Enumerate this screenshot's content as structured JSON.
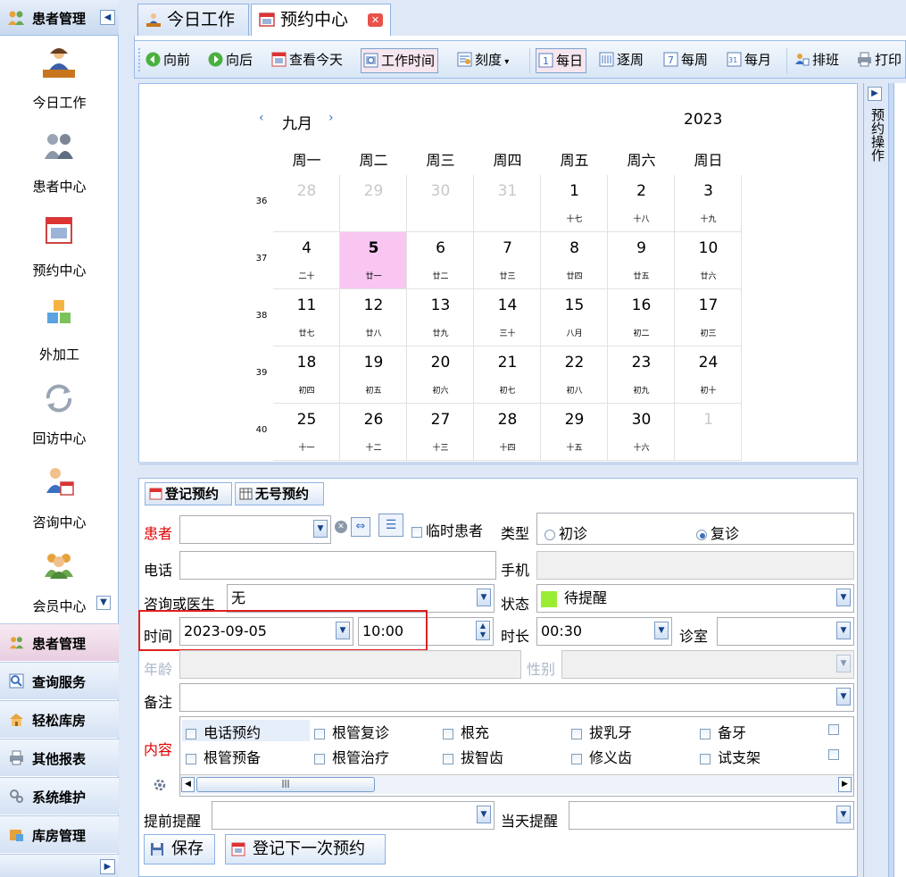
{
  "sidebar": {
    "title": "患者管理",
    "nav_items": [
      {
        "label": "今日工作",
        "icon": "doctor-desk-icon"
      },
      {
        "label": "患者中心",
        "icon": "patients-icon"
      },
      {
        "label": "预约中心",
        "icon": "calendar-icon"
      },
      {
        "label": "外加工",
        "icon": "cubes-icon"
      },
      {
        "label": "回访中心",
        "icon": "refresh-icon"
      },
      {
        "label": "咨询中心",
        "icon": "consult-icon"
      },
      {
        "label": "会员中心",
        "icon": "members-icon"
      }
    ],
    "accordion": [
      {
        "label": "患者管理",
        "icon": "patients-small-icon",
        "active": true
      },
      {
        "label": "查询服务",
        "icon": "search-icon"
      },
      {
        "label": "轻松库房",
        "icon": "warehouse-icon"
      },
      {
        "label": "其他报表",
        "icon": "printer-icon"
      },
      {
        "label": "系统维护",
        "icon": "gears-icon"
      },
      {
        "label": "库房管理",
        "icon": "storage-icon"
      }
    ]
  },
  "tabs": [
    {
      "label": "今日工作",
      "icon": "doctor-icon"
    },
    {
      "label": "预约中心",
      "icon": "calendar-small-icon",
      "active": true
    }
  ],
  "toolbar": {
    "prev": "向前",
    "next": "向后",
    "today": "查看今天",
    "work_time": "工作时间",
    "scale": "刻度",
    "daily": "每日",
    "by_week": "逐周",
    "weekly": "每周",
    "monthly": "每月",
    "schedule": "排班",
    "print": "打印"
  },
  "calendar": {
    "month": "九月",
    "year": "2023",
    "weekdays": [
      "周一",
      "周二",
      "周三",
      "周四",
      "周五",
      "周六",
      "周日"
    ],
    "weeks": [
      {
        "num": "36",
        "days": [
          {
            "d": "28",
            "l": "",
            "other": true
          },
          {
            "d": "29",
            "l": "",
            "other": true
          },
          {
            "d": "30",
            "l": "",
            "other": true
          },
          {
            "d": "31",
            "l": "",
            "other": true
          },
          {
            "d": "1",
            "l": "十七"
          },
          {
            "d": "2",
            "l": "十八"
          },
          {
            "d": "3",
            "l": "十九"
          }
        ]
      },
      {
        "num": "37",
        "days": [
          {
            "d": "4",
            "l": "二十"
          },
          {
            "d": "5",
            "l": "廿一",
            "selected": true
          },
          {
            "d": "6",
            "l": "廿二"
          },
          {
            "d": "7",
            "l": "廿三"
          },
          {
            "d": "8",
            "l": "廿四"
          },
          {
            "d": "9",
            "l": "廿五"
          },
          {
            "d": "10",
            "l": "廿六"
          }
        ]
      },
      {
        "num": "38",
        "days": [
          {
            "d": "11",
            "l": "廿七"
          },
          {
            "d": "12",
            "l": "廿八"
          },
          {
            "d": "13",
            "l": "廿九"
          },
          {
            "d": "14",
            "l": "三十"
          },
          {
            "d": "15",
            "l": "八月"
          },
          {
            "d": "16",
            "l": "初二"
          },
          {
            "d": "17",
            "l": "初三"
          }
        ]
      },
      {
        "num": "39",
        "days": [
          {
            "d": "18",
            "l": "初四"
          },
          {
            "d": "19",
            "l": "初五"
          },
          {
            "d": "20",
            "l": "初六"
          },
          {
            "d": "21",
            "l": "初七"
          },
          {
            "d": "22",
            "l": "初八"
          },
          {
            "d": "23",
            "l": "初九"
          },
          {
            "d": "24",
            "l": "初十"
          }
        ]
      },
      {
        "num": "40",
        "days": [
          {
            "d": "25",
            "l": "十一"
          },
          {
            "d": "26",
            "l": "十二"
          },
          {
            "d": "27",
            "l": "十三"
          },
          {
            "d": "28",
            "l": "十四"
          },
          {
            "d": "29",
            "l": "十五"
          },
          {
            "d": "30",
            "l": "十六"
          },
          {
            "d": "1",
            "l": "",
            "other": true
          }
        ]
      }
    ]
  },
  "right_panel": {
    "label": "预约操作"
  },
  "form": {
    "subtabs": [
      "登记预约",
      "无号预约"
    ],
    "patient_label": "患者",
    "patient_value": "",
    "temp_patient": "临时患者",
    "type_label": "类型",
    "type_first": "初诊",
    "type_return": "复诊",
    "phone_label": "电话",
    "mobile_label": "手机",
    "doctor_label": "咨询或医生",
    "doctor_value": "无",
    "status_label": "状态",
    "status_value": "待提醒",
    "status_color": "#99ee33",
    "time_label": "时间",
    "date_value": "2023-09-05",
    "time_value": "10:00",
    "duration_label": "时长",
    "duration_value": "00:30",
    "room_label": "诊室",
    "age_label": "年龄",
    "gender_label": "性别",
    "note_label": "备注",
    "content_label": "内容",
    "content_row1": [
      "电话预约",
      "根管复诊",
      "根充",
      "拔乳牙",
      "备牙"
    ],
    "content_row2": [
      "根管预备",
      "根管治疗",
      "拔智齿",
      "修义齿",
      "试支架"
    ],
    "advance_label": "提前提醒",
    "sameday_label": "当天提醒",
    "save_btn": "保存",
    "next_btn": "登记下一次预约",
    "highlight_color": "#e02020"
  }
}
